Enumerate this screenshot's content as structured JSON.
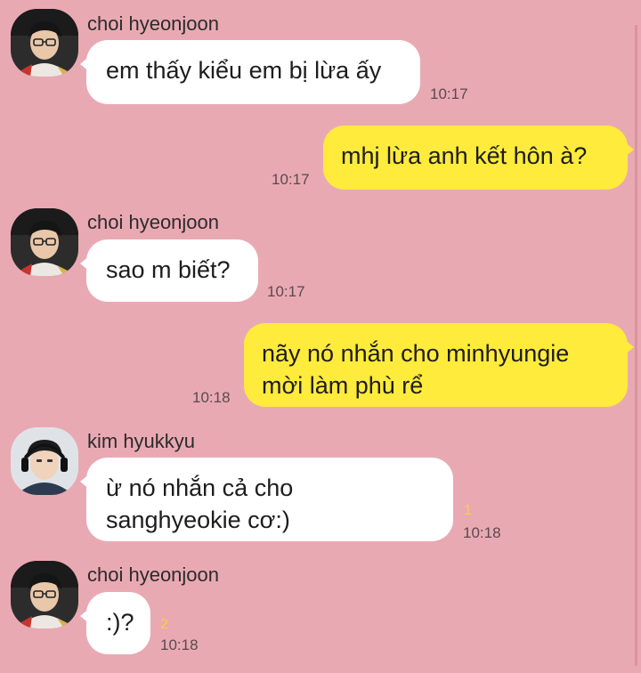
{
  "chat": {
    "messages": [
      {
        "sender": "choi hyeonjoon",
        "direction": "incoming",
        "text": "em thấy kiểu em bị lừa ấy",
        "time": "10:17",
        "avatar_icon": "avatar-choi-hyeonjoon"
      },
      {
        "direction": "outgoing",
        "text": "mhj lừa anh kết hôn à?",
        "time": "10:17"
      },
      {
        "sender": "choi hyeonjoon",
        "direction": "incoming",
        "text": "sao m biết?",
        "time": "10:17",
        "avatar_icon": "avatar-choi-hyeonjoon"
      },
      {
        "direction": "outgoing",
        "text": "nãy nó nhắn cho minhyungie\nmời làm phù rể",
        "time": "10:18"
      },
      {
        "sender": "kim hyukkyu",
        "direction": "incoming",
        "text": "ừ nó nhắn cả cho\nsanghyeokie cơ:)",
        "time": "10:18",
        "unread": "1",
        "avatar_icon": "avatar-kim-hyukkyu"
      },
      {
        "sender": "choi hyeonjoon",
        "direction": "incoming",
        "text": ":)?",
        "time": "10:18",
        "unread": "2",
        "avatar_icon": "avatar-choi-hyeonjoon"
      }
    ]
  },
  "colors": {
    "background": "#e9a9b3",
    "incoming_bubble": "#ffffff",
    "outgoing_bubble": "#ffeb3b",
    "unread_count": "#f7d23c"
  }
}
